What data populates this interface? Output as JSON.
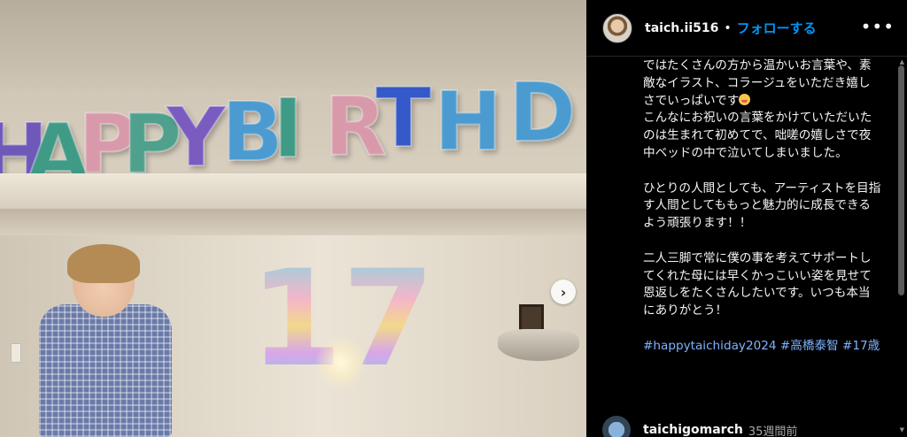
{
  "post": {
    "photo": {
      "balloons_top": [
        "H",
        "A",
        "P",
        "P",
        "Y",
        "B",
        "I",
        "R",
        "T",
        "H",
        "D"
      ],
      "balloons_number": "17",
      "carousel_next": "›",
      "colors": {
        "H": "#6e58b8",
        "A": "#3f9a86",
        "P": "#d89aaa",
        "P2": "#4fa08c",
        "Y": "#7a5cc0",
        "B": "#4b9bd0",
        "I": "#3f9a86",
        "R": "#d89aaa",
        "T": "#3559c8",
        "H2": "#4b9bd0",
        "D": "#4b9bd0"
      }
    },
    "header": {
      "username": "taich.ii516",
      "separator": "•",
      "follow": "フォローする",
      "more": "•••"
    },
    "caption": {
      "lines": [
        "ではたくさんの方から温かいお言葉や、素敵なイラスト、コラージュをいただき嬉しさでいっぱいです",
        "こんなにお祝いの言葉をかけていただいたのは生まれて初めてで、咄嗟の嬉しさで夜中ベッドの中で泣いてしまいました。",
        "ひとりの人間としても、アーティストを目指す人間としてももっと魅力的に成長できるよう頑張ります！！",
        "二人三脚で常に僕の事を考えてサポートしてくれた母には早くかっこいい姿を見せて恩返しをたくさんしたいです。いつも本当にありがとう！"
      ],
      "hashtags": [
        "#happytaichiday2024",
        "#高橋泰智",
        "#17歳"
      ]
    },
    "comment": {
      "username": "taichigomarch",
      "time": "35週間前"
    }
  }
}
